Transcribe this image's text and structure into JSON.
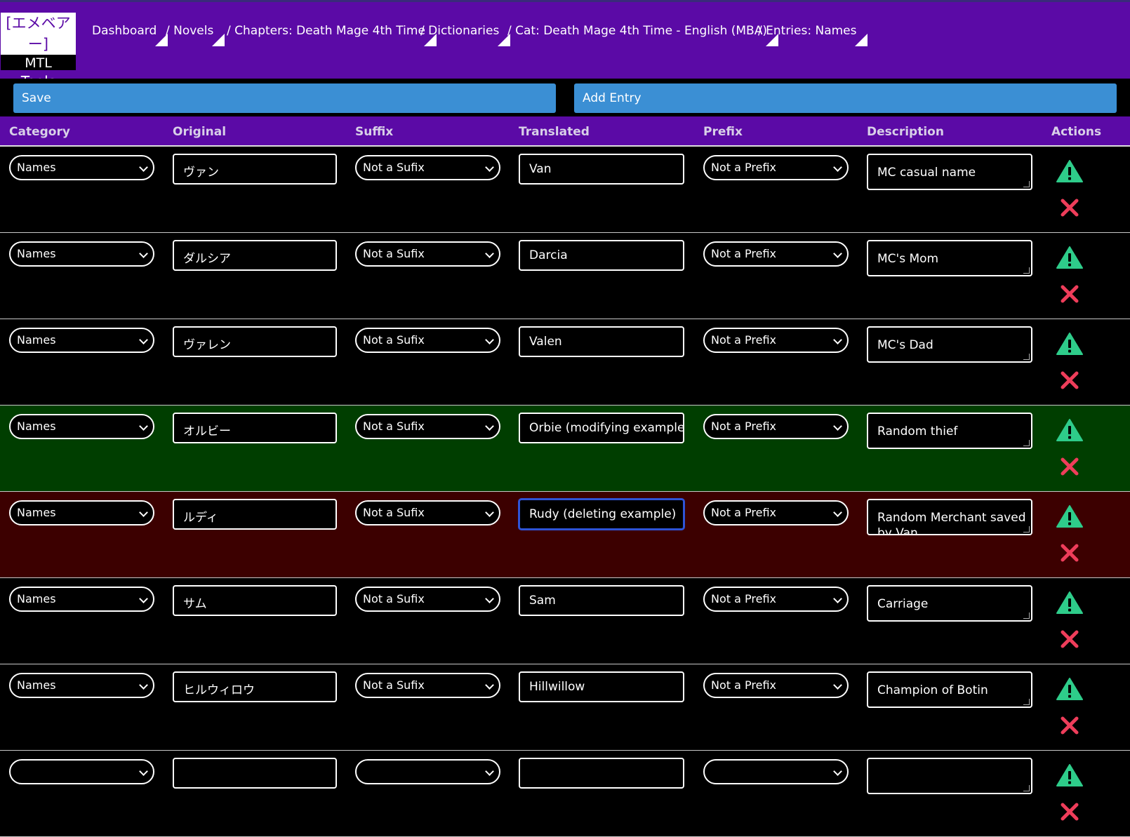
{
  "logo": {
    "line1": "[エメベアー]",
    "line2": "MTL",
    "line3": "Tools"
  },
  "breadcrumbs": [
    "Dashboard",
    "/ Novels",
    "/ Chapters: Death Mage 4th Time",
    "/ Dictionaries",
    "/ Cat: Death Mage 4th Time - English (MBA)",
    "/ Entries: Names"
  ],
  "toolbar": {
    "save_label": "Save",
    "add_entry_label": "Add Entry"
  },
  "columns": [
    "Category",
    "Original",
    "Suffix",
    "Translated",
    "Prefix",
    "Description",
    "Actions"
  ],
  "colors": {
    "nav_bg": "#5b0aa6",
    "button_bg": "#3b8fd4",
    "row_modified": "#003e00",
    "row_deleted": "#3c0000",
    "warn_icon": "#2ecc8a",
    "delete_icon": "#ee3d5a"
  },
  "rows": [
    {
      "category": "Names",
      "original": "ヴァン",
      "suffix": "Not a Sufix",
      "translated": "Van",
      "prefix": "Not a Prefix",
      "description": "MC casual name",
      "state": "normal"
    },
    {
      "category": "Names",
      "original": "ダルシア",
      "suffix": "Not a Sufix",
      "translated": "Darcia",
      "prefix": "Not a Prefix",
      "description": "MC's Mom",
      "state": "normal"
    },
    {
      "category": "Names",
      "original": "ヴァレン",
      "suffix": "Not a Sufix",
      "translated": "Valen",
      "prefix": "Not a Prefix",
      "description": "MC's Dad",
      "state": "normal"
    },
    {
      "category": "Names",
      "original": "オルビー",
      "suffix": "Not a Sufix",
      "translated": "Orbie (modifying example)",
      "prefix": "Not a Prefix",
      "description": "Random thief",
      "state": "modified"
    },
    {
      "category": "Names",
      "original": "ルディ",
      "suffix": "Not a Sufix",
      "translated": "Rudy (deleting example)",
      "prefix": "Not a Prefix",
      "description": "Random Merchant saved by Van",
      "state": "deleted",
      "focused": true
    },
    {
      "category": "Names",
      "original": "サム",
      "suffix": "Not a Sufix",
      "translated": "Sam",
      "prefix": "Not a Prefix",
      "description": "Carriage",
      "state": "normal"
    },
    {
      "category": "Names",
      "original": "ヒルウィロウ",
      "suffix": "Not a Sufix",
      "translated": "Hillwillow",
      "prefix": "Not a Prefix",
      "description": "Champion of Botin",
      "state": "normal"
    },
    {
      "category": "",
      "original": "",
      "suffix": "",
      "translated": "",
      "prefix": "",
      "description": "",
      "state": "normal"
    }
  ]
}
